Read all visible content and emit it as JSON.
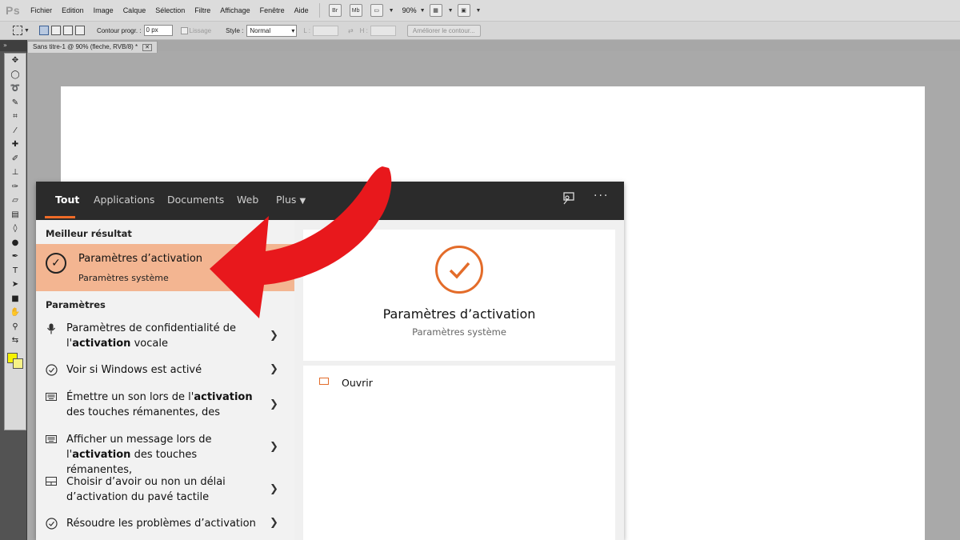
{
  "photoshop": {
    "logo": "Ps",
    "menu": [
      "Fichier",
      "Edition",
      "Image",
      "Calque",
      "Sélection",
      "Filtre",
      "Affichage",
      "Fenêtre",
      "Aide"
    ],
    "toolbar_badges": {
      "br": "Br",
      "mb": "Mb"
    },
    "zoom": "90%",
    "options": {
      "contour_label": "Contour progr. :",
      "contour_value": "0 px",
      "lissage": "Lissage",
      "style_label": "Style :",
      "style_value": "Normal",
      "l_label": "L :",
      "h_label": "H :",
      "refine_button": "Améliorer le contour..."
    },
    "document_tab": "Sans titre-1 @ 90% (fleche, RVB/8) *",
    "foreground_color": "#f6f200",
    "background_color": "#f6f287"
  },
  "search": {
    "tabs": [
      "Tout",
      "Applications",
      "Documents",
      "Web",
      "Plus"
    ],
    "best_result_heading": "Meilleur résultat",
    "best_result": {
      "title": "Paramètres d’activation",
      "subtitle": "Paramètres système"
    },
    "settings_heading": "Paramètres",
    "settings_items": [
      {
        "icon": "microphone-icon",
        "line1_pre": "Paramètres de confidentialité de",
        "line2_pre": "l'",
        "bold": "activation",
        "line2_post": " vocale"
      },
      {
        "icon": "check-circle-icon",
        "text": "Voir si Windows est activé"
      },
      {
        "icon": "keyboard-icon",
        "line1_pre": "Émettre un son lors de l'",
        "bold": "activation",
        "line2": "des touches rémanentes, des"
      },
      {
        "icon": "keyboard-icon",
        "line1": "Afficher un message lors de",
        "line2_pre": "l'",
        "bold": "activation",
        "line2_post": " des touches rémanentes,"
      },
      {
        "icon": "touchpad-icon",
        "line1": "Choisir d’avoir ou non un délai",
        "line2": "d’activation du pavé tactile"
      },
      {
        "icon": "check-circle-icon",
        "text": "Résoudre les problèmes d’activation"
      }
    ],
    "preview": {
      "title": "Paramètres d’activation",
      "subtitle": "Paramètres système",
      "open_label": "Ouvrir"
    },
    "accent_color": "#e36c2a",
    "highlight_color": "#f3b591",
    "arrow_color": "#e8181c"
  }
}
